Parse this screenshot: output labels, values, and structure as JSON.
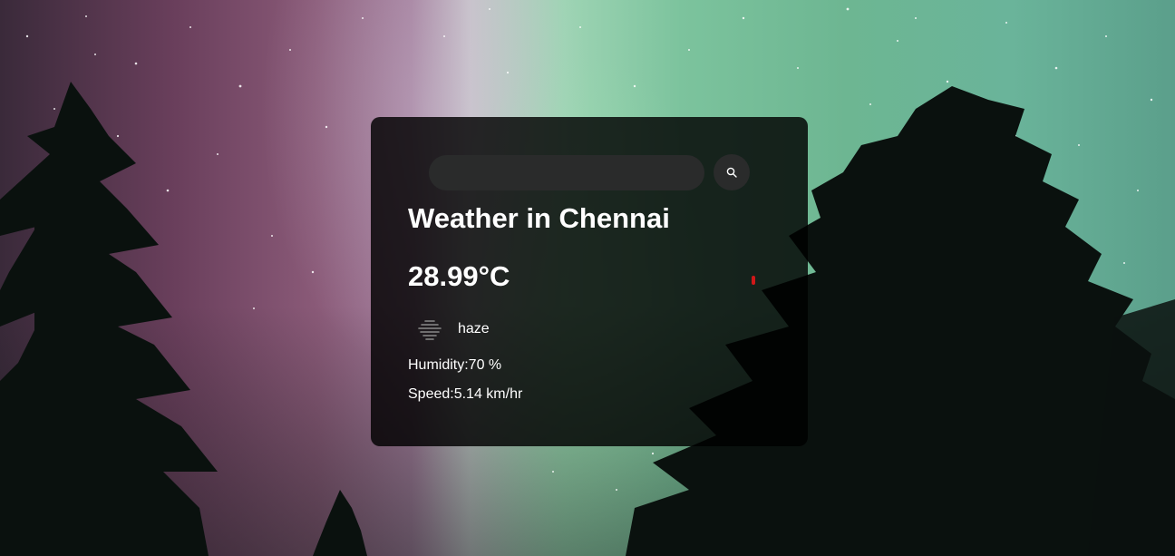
{
  "background": {
    "description_colors": [
      "#6a3f5c",
      "#c7c2c9",
      "#7cc39d",
      "#5b9f8b"
    ]
  },
  "search": {
    "placeholder": "",
    "value": "",
    "icon": "search-icon"
  },
  "weather": {
    "title": "Weather in Chennai",
    "temperature": "28.99°C",
    "description": "haze",
    "description_icon": "haze-icon",
    "humidity": "Humidity:70 %",
    "speed": "Speed:5.14 km/hr"
  },
  "colors": {
    "card_bg": "#000000",
    "input_bg": "#2a2b2b",
    "text": "#ffffff"
  }
}
